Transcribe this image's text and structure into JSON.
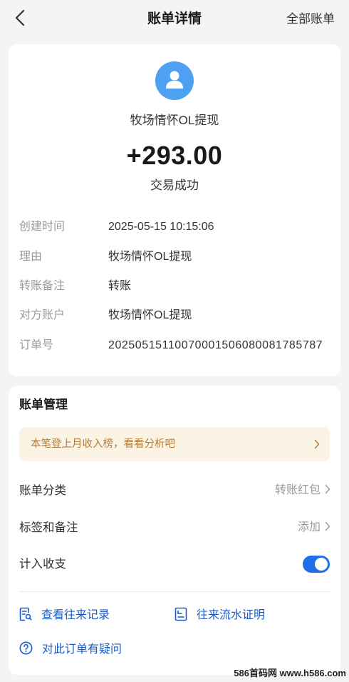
{
  "header": {
    "back_icon": "chevron-left-icon",
    "title": "账单详情",
    "all_bills": "全部账单"
  },
  "summary": {
    "avatar_icon": "user-icon",
    "counterparty": "牧场情怀OL提现",
    "amount": "+293.00",
    "status": "交易成功"
  },
  "details": [
    {
      "label": "创建时间",
      "value": "2025-05-15 10:15:06"
    },
    {
      "label": "理由",
      "value": "牧场情怀OL提现"
    },
    {
      "label": "转账备注",
      "value": "转账"
    },
    {
      "label": "对方账户",
      "value": "牧场情怀OL提现"
    },
    {
      "label": "订单号",
      "value": "20250515110070001506080081785787"
    }
  ],
  "management": {
    "title": "账单管理",
    "banner": "本笔登上月收入榜，看看分析吧",
    "rows": [
      {
        "label": "账单分类",
        "value": "转账红包"
      },
      {
        "label": "标签和备注",
        "value": "添加"
      }
    ],
    "include_label": "计入收支",
    "include_enabled": true
  },
  "links": {
    "history": "查看往来记录",
    "proof": "往来流水证明",
    "question": "对此订单有疑问"
  },
  "watermark": "586首码网 www.h586.com",
  "colors": {
    "background": "#f4f4f6",
    "avatar": "#4ea1f2",
    "link_blue": "#1b5bc9",
    "toggle_on": "#1e6fe8",
    "banner_bg": "#fbf3e4",
    "banner_text": "#b07d3c"
  }
}
